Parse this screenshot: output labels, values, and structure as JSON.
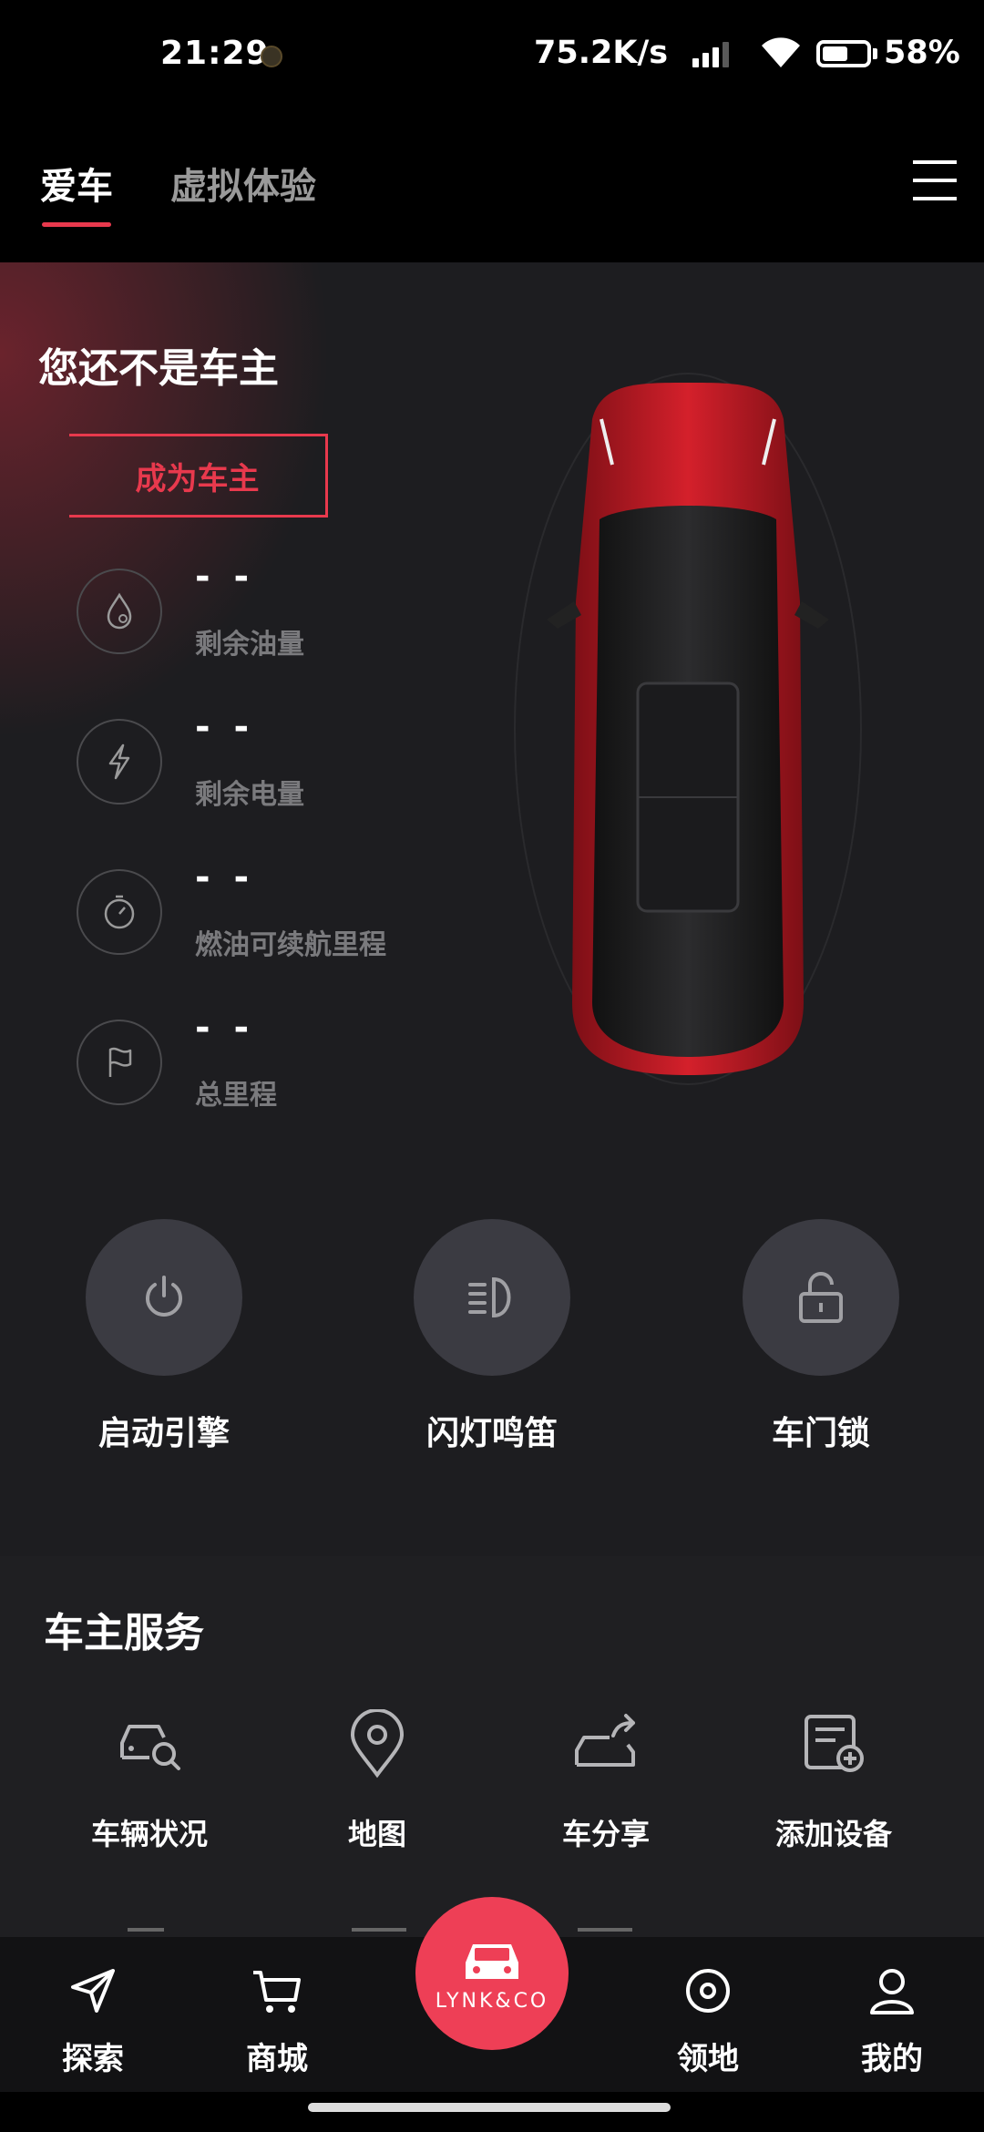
{
  "status_bar": {
    "time": "21:29",
    "network_speed": "75.2K/s",
    "battery_percent": "58%",
    "battery_level": 0.58
  },
  "header": {
    "tabs": [
      {
        "label": "爱车",
        "active": true
      },
      {
        "label": "虚拟体验",
        "active": false
      }
    ],
    "menu_icon": "hamburger-menu-icon"
  },
  "car_panel": {
    "title": "您还不是车主",
    "cta_label": "成为车主",
    "accent_color": "#e8394d",
    "stats": [
      {
        "icon": "fuel-drop-icon",
        "value": "- -",
        "label": "剩余油量"
      },
      {
        "icon": "lightning-icon",
        "value": "- -",
        "label": "剩余电量"
      },
      {
        "icon": "timer-icon",
        "value": "- -",
        "label": "燃油可续航里程"
      },
      {
        "icon": "flag-icon",
        "value": "- -",
        "label": "总里程"
      }
    ],
    "controls": [
      {
        "icon": "power-icon",
        "label": "启动引擎"
      },
      {
        "icon": "headlight-icon",
        "label": "闪灯鸣笛"
      },
      {
        "icon": "unlock-icon",
        "label": "车门锁"
      }
    ]
  },
  "services": {
    "title": "车主服务",
    "items": [
      {
        "icon": "car-search-icon",
        "label": "车辆状况"
      },
      {
        "icon": "map-pin-icon",
        "label": "地图"
      },
      {
        "icon": "car-share-icon",
        "label": "车分享"
      },
      {
        "icon": "add-device-icon",
        "label": "添加设备"
      }
    ]
  },
  "bottom_nav": {
    "items": [
      {
        "icon": "send-icon",
        "label": "探索"
      },
      {
        "icon": "cart-icon",
        "label": "商城"
      },
      {
        "icon": "target-icon",
        "label": "领地"
      },
      {
        "icon": "person-icon",
        "label": "我的"
      }
    ],
    "center_brand": "LYNK&CO",
    "center_color": "#ee3f56"
  }
}
